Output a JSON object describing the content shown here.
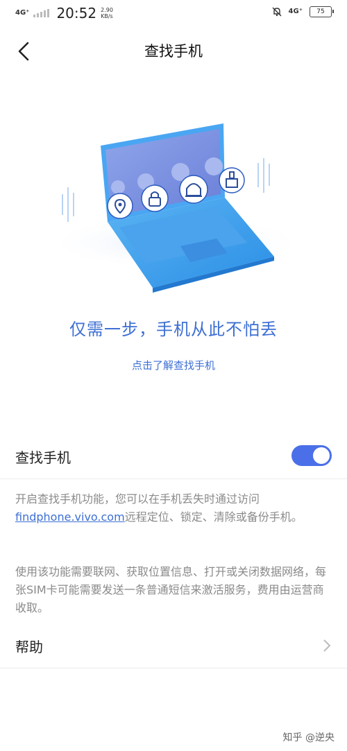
{
  "status_bar": {
    "network_left": "4G⁺",
    "time": "20:52",
    "speed_value": "2.90",
    "speed_unit": "KB/s",
    "network_right": "4G⁺",
    "battery": "75"
  },
  "header": {
    "title": "查找手机"
  },
  "hero": {
    "slogan": "仅需一步，手机从此不怕丢",
    "learn_link": "点击了解查找手机"
  },
  "toggle_row": {
    "label": "查找手机",
    "enabled": true
  },
  "description": {
    "para1_prefix": "开启查找手机功能，您可以在手机丢失时通过访问",
    "para1_link": "findphone.vivo.com",
    "para1_suffix": "远程定位、锁定、清除或备份手机。",
    "para2": "使用该功能需要联网、获取位置信息、打开或关闭数据网络，每张SIM卡可能需要发送一条普通短信来激活服务，费用由运营商收取。"
  },
  "help_row": {
    "label": "帮助"
  },
  "watermark": "知乎 @逆央",
  "colors": {
    "accent": "#3d6fd3",
    "toggle_on": "#4a6fe8"
  }
}
